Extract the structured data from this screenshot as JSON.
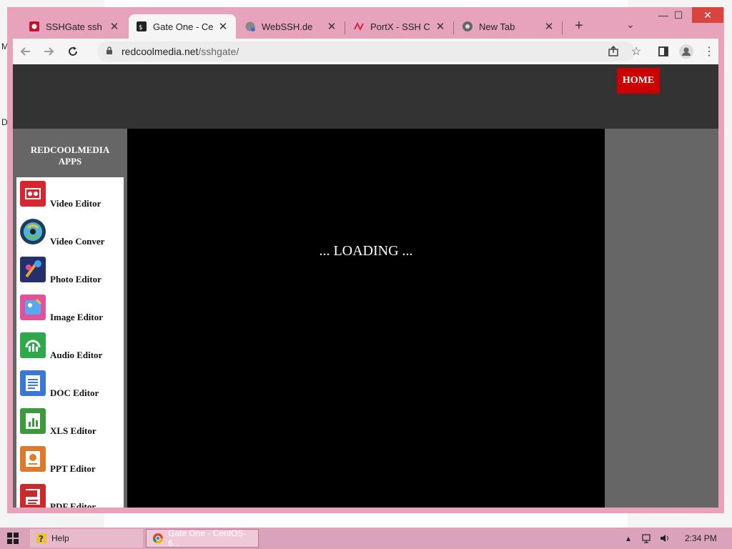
{
  "desktop": {
    "left_letters": [
      "M",
      "D"
    ]
  },
  "browser": {
    "tabs": [
      {
        "title": "SSHGate ssh clie",
        "icon": "red-square-icon"
      },
      {
        "title": "Gate One - Cent",
        "icon": "terminal-icon",
        "active": true
      },
      {
        "title": "WebSSH.de",
        "icon": "globe-icon"
      },
      {
        "title": "PortX - SSH Clie",
        "icon": "portx-icon"
      },
      {
        "title": "New Tab",
        "icon": "chrome-icon"
      }
    ],
    "new_tab": "+",
    "tab_list": "⌄",
    "window_controls": {
      "minimize": "—",
      "maximize": "☐",
      "close": "✕"
    },
    "url_domain": "redcoolmedia.net",
    "url_path": "/sshgate/"
  },
  "page": {
    "home_label": "HOME",
    "sidebar_title_line1": "REDCOOLMEDIA",
    "sidebar_title_line2": "APPS",
    "apps": [
      {
        "label": "Video Editor",
        "color": "#d9262e"
      },
      {
        "label": "Video Conver",
        "color": "#2f8fbf"
      },
      {
        "label": "Photo Editor",
        "color": "#2f57c7"
      },
      {
        "label": "Image Editor",
        "color": "#d94a8a"
      },
      {
        "label": "Audio Editor",
        "color": "#2fa84a"
      },
      {
        "label": "DOC Editor",
        "color": "#3b78d6"
      },
      {
        "label": "XLS Editor",
        "color": "#3b9a3b"
      },
      {
        "label": "PPT Editor",
        "color": "#e07a2b"
      },
      {
        "label": "PDF Editor",
        "color": "#c92a2a"
      }
    ],
    "loading_text": "... LOADING ..."
  },
  "taskbar": {
    "help_label": "Help",
    "gate_label": "Gate One - CentOS-6...",
    "clock": "2:34 PM"
  }
}
